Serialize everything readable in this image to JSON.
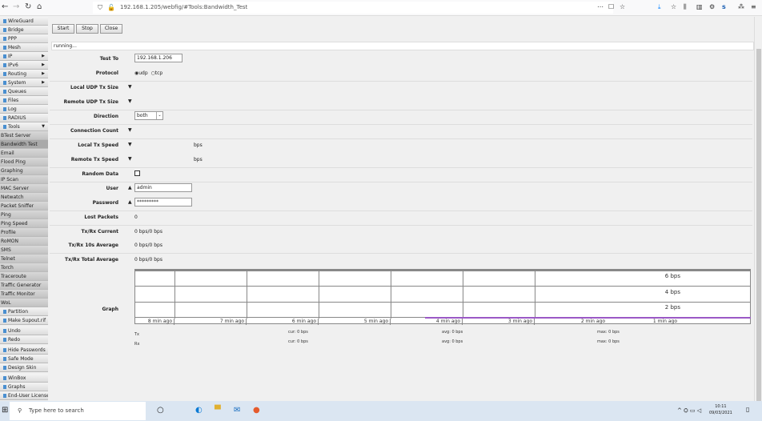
{
  "browser": {
    "url": "192.168.1.205/webfig/#Tools:Bandwidth_Test"
  },
  "sidebar": {
    "items": [
      {
        "label": "WireGuard",
        "type": "top"
      },
      {
        "label": "Bridge",
        "type": "top"
      },
      {
        "label": "PPP",
        "type": "top"
      },
      {
        "label": "Mesh",
        "type": "top"
      },
      {
        "label": "IP",
        "type": "top",
        "arrow": "▶"
      },
      {
        "label": "IPv6",
        "type": "top",
        "arrow": "▶"
      },
      {
        "label": "Routing",
        "type": "top",
        "arrow": "▶"
      },
      {
        "label": "System",
        "type": "top",
        "arrow": "▶"
      },
      {
        "label": "Queues",
        "type": "top"
      },
      {
        "label": "Files",
        "type": "top"
      },
      {
        "label": "Log",
        "type": "top"
      },
      {
        "label": "RADIUS",
        "type": "top"
      },
      {
        "label": "Tools",
        "type": "top",
        "arrow": "▼"
      },
      {
        "label": "BTest Server",
        "type": "sub"
      },
      {
        "label": "Bandwidth Test",
        "type": "sel"
      },
      {
        "label": "Email",
        "type": "sub"
      },
      {
        "label": "Flood Ping",
        "type": "sub"
      },
      {
        "label": "Graphing",
        "type": "sub"
      },
      {
        "label": "IP Scan",
        "type": "sub"
      },
      {
        "label": "MAC Server",
        "type": "sub"
      },
      {
        "label": "Netwatch",
        "type": "sub"
      },
      {
        "label": "Packet Sniffer",
        "type": "sub"
      },
      {
        "label": "Ping",
        "type": "sub"
      },
      {
        "label": "Ping Speed",
        "type": "sub"
      },
      {
        "label": "Profile",
        "type": "sub"
      },
      {
        "label": "RoMON",
        "type": "sub"
      },
      {
        "label": "SMS",
        "type": "sub"
      },
      {
        "label": "Telnet",
        "type": "sub"
      },
      {
        "label": "Torch",
        "type": "sub"
      },
      {
        "label": "Traceroute",
        "type": "sub"
      },
      {
        "label": "Traffic Generator",
        "type": "sub"
      },
      {
        "label": "Traffic Monitor",
        "type": "sub"
      },
      {
        "label": "WoL",
        "type": "sub"
      },
      {
        "label": "Partition",
        "type": "top"
      },
      {
        "label": "Make Supout.rif",
        "type": "top"
      },
      {
        "label": "Undo",
        "type": "gap"
      },
      {
        "label": "Redo",
        "type": "top"
      },
      {
        "label": "Hide Passwords",
        "type": "gap"
      },
      {
        "label": "Safe Mode",
        "type": "top"
      },
      {
        "label": "Design Skin",
        "type": "top"
      },
      {
        "label": "WinBox",
        "type": "gap"
      },
      {
        "label": "Graphs",
        "type": "top"
      },
      {
        "label": "End-User License",
        "type": "top"
      }
    ]
  },
  "toolbar": {
    "start": "Start",
    "stop": "Stop",
    "close": "Close"
  },
  "status": "running...",
  "form": {
    "test_to": {
      "label": "Test To",
      "value": "192.168.1.206"
    },
    "protocol": {
      "label": "Protocol",
      "udp": "udp",
      "tcp": "tcp",
      "selected": "udp"
    },
    "local_udp": {
      "label": "Local UDP Tx Size"
    },
    "remote_udp": {
      "label": "Remote UDP Tx Size"
    },
    "direction": {
      "label": "Direction",
      "value": "both"
    },
    "conn_count": {
      "label": "Connection Count"
    },
    "local_tx": {
      "label": "Local Tx Speed",
      "unit": "bps"
    },
    "remote_tx": {
      "label": "Remote Tx Speed",
      "unit": "bps"
    },
    "random": {
      "label": "Random Data",
      "checked": false
    },
    "user": {
      "label": "User",
      "value": "admin"
    },
    "password": {
      "label": "Password",
      "value": "*********"
    },
    "lost": {
      "label": "Lost Packets",
      "value": "0"
    },
    "current": {
      "label": "Tx/Rx Current",
      "value": "0 bps/0 bps"
    },
    "avg10": {
      "label": "Tx/Rx 10s Average",
      "value": "0 bps/0 bps"
    },
    "total": {
      "label": "Tx/Rx Total Average",
      "value": "0 bps/0 bps"
    },
    "graph": {
      "label": "Graph"
    }
  },
  "graph": {
    "y_labels": [
      "6 bps",
      "4 bps",
      "2 bps"
    ],
    "x_labels": [
      "8 min ago",
      "7 min ago",
      "6 min ago",
      "5 min ago",
      "4 min ago",
      "3 min ago",
      "2 min ago",
      "1 min ago"
    ],
    "tx_color": "#9b59c6",
    "legend": [
      {
        "name": "Tx",
        "cur": "cur: 0 bps",
        "avg": "avg: 0 bps",
        "max": "max: 0 bps"
      },
      {
        "name": "Rx",
        "cur": "cur: 0 bps",
        "avg": "avg: 0 bps",
        "max": "max: 0 bps"
      }
    ]
  },
  "taskbar": {
    "search_placeholder": "Type here to search",
    "time": "10:11",
    "date": "09/03/2021"
  }
}
